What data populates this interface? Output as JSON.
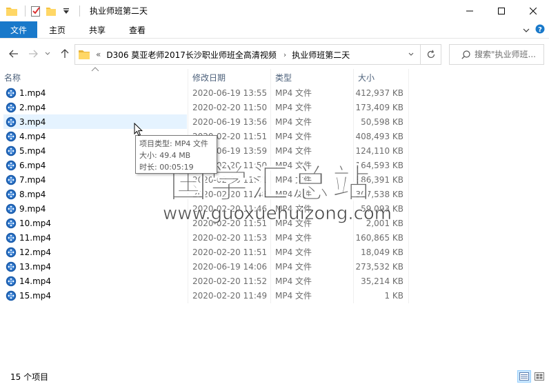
{
  "window": {
    "title": "执业师班第二天",
    "accent": "#1979ca"
  },
  "ribbon": {
    "tabs": [
      {
        "label": "文件"
      },
      {
        "label": "主页"
      },
      {
        "label": "共享"
      },
      {
        "label": "查看"
      }
    ]
  },
  "address": {
    "overflow": "«",
    "crumbs": [
      {
        "label": "D306 莫亚老师2017长沙职业师班全高清视频"
      },
      {
        "label": "执业师班第二天"
      }
    ],
    "separator": "›"
  },
  "search": {
    "placeholder": "搜索\"执业师班..."
  },
  "columns": {
    "name": "名称",
    "date": "修改日期",
    "type": "类型",
    "size": "大小"
  },
  "files": [
    {
      "name": "1.mp4",
      "date": "2020-06-19 13:55",
      "type": "MP4 文件",
      "size": "412,937 KB"
    },
    {
      "name": "2.mp4",
      "date": "2020-02-20 11:50",
      "type": "MP4 文件",
      "size": "173,409 KB"
    },
    {
      "name": "3.mp4",
      "date": "2020-06-19 13:56",
      "type": "MP4 文件",
      "size": "50,598 KB"
    },
    {
      "name": "4.mp4",
      "date": "2020-02-20 11:51",
      "type": "MP4 文件",
      "size": "408,493 KB"
    },
    {
      "name": "5.mp4",
      "date": "2020-06-19 13:59",
      "type": "MP4 文件",
      "size": "124,110 KB"
    },
    {
      "name": "6.mp4",
      "date": "2020-02-20 11:50",
      "type": "MP4 文件",
      "size": "164,593 KB"
    },
    {
      "name": "7.mp4",
      "date": "2020-02-20 11:51",
      "type": "MP4 文件",
      "size": "886,391 KB"
    },
    {
      "name": "8.mp4",
      "date": "2020-02-20 11:48",
      "type": "MP4 文件",
      "size": "307,538 KB"
    },
    {
      "name": "9.mp4",
      "date": "2020-02-20 11:46",
      "type": "MP4 文件",
      "size": "59,093 KB"
    },
    {
      "name": "10.mp4",
      "date": "2020-02-20 11:51",
      "type": "MP4 文件",
      "size": "2,001 KB"
    },
    {
      "name": "11.mp4",
      "date": "2020-02-20 11:53",
      "type": "MP4 文件",
      "size": "160,865 KB"
    },
    {
      "name": "12.mp4",
      "date": "2020-02-20 11:51",
      "type": "MP4 文件",
      "size": "18,049 KB"
    },
    {
      "name": "13.mp4",
      "date": "2020-06-19 14:06",
      "type": "MP4 文件",
      "size": "273,532 KB"
    },
    {
      "name": "14.mp4",
      "date": "2020-02-20 11:52",
      "type": "MP4 文件",
      "size": "35,214 KB"
    },
    {
      "name": "15.mp4",
      "date": "2020-02-20 11:49",
      "type": "MP4 文件",
      "size": "1 KB"
    }
  ],
  "hovered_index": 2,
  "tooltip": {
    "line1": "项目类型: MP4 文件",
    "line2": "大小: 49.4 MB",
    "line3": "时长: 00:05:19"
  },
  "watermark": {
    "cn": "国学汇总站",
    "en": "www.guoxuehuizong.com"
  },
  "status": {
    "count": "15 个项目"
  },
  "icons": {
    "file": "video-file-icon",
    "folder": "folder-icon"
  }
}
